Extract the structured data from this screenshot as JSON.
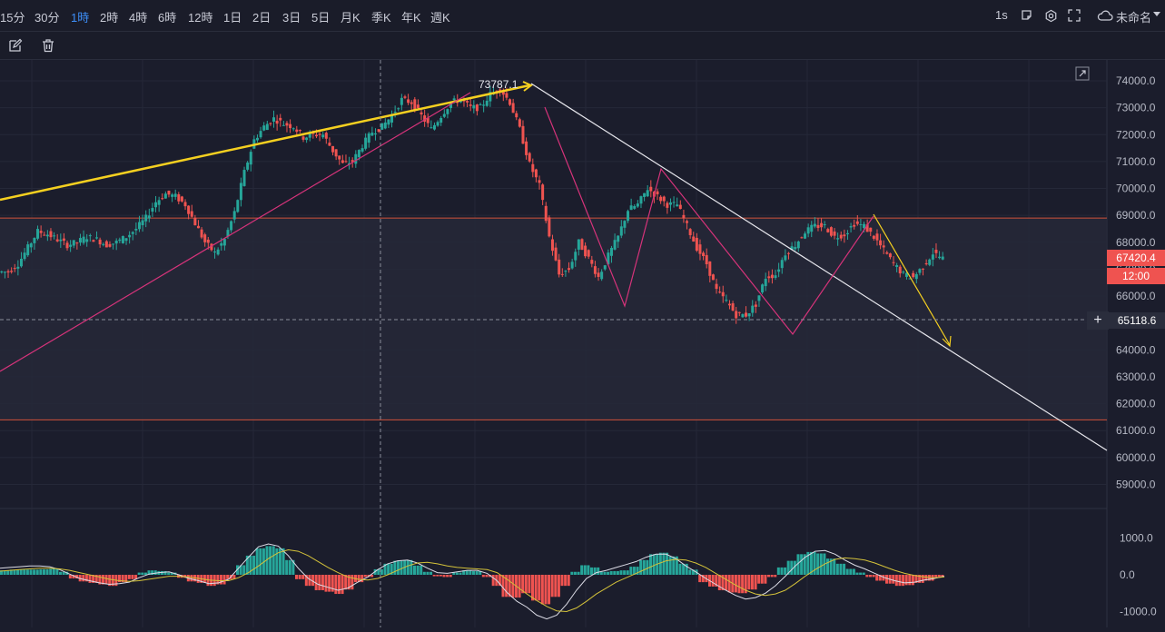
{
  "timeframes": [
    {
      "label": "15分",
      "active": false
    },
    {
      "label": "30分",
      "active": false
    },
    {
      "label": "1時",
      "active": true
    },
    {
      "label": "2時",
      "active": false
    },
    {
      "label": "4時",
      "active": false
    },
    {
      "label": "6時",
      "active": false
    },
    {
      "label": "12時",
      "active": false
    },
    {
      "label": "1日",
      "active": false
    },
    {
      "label": "2日",
      "active": false
    },
    {
      "label": "3日",
      "active": false
    },
    {
      "label": "5日",
      "active": false
    },
    {
      "label": "月K",
      "active": false
    },
    {
      "label": "季K",
      "active": false
    },
    {
      "label": "年K",
      "active": false
    },
    {
      "label": "週K",
      "active": false
    }
  ],
  "topright": {
    "interval": "1s",
    "layout_name": "未命名"
  },
  "icons": {
    "screenshot": "screenshot-icon",
    "settings": "gear-icon",
    "fullscreen": "fullscreen-icon",
    "cloud": "cloud-icon",
    "edit": "edit-icon",
    "delete": "trash-icon",
    "expand": "expand-icon",
    "add": "plus-icon"
  },
  "colors": {
    "up": "#26a69a",
    "down": "#ef5350",
    "accent": "#3d8ef8",
    "trend_yellow": "#f5d020",
    "trend_pink": "#d6337a",
    "trend_white": "#e8e8ee",
    "hline": "#d0523a",
    "macd_line": "#dcdce6",
    "signal_line": "#d4c23a"
  },
  "chart_data": {
    "type": "line",
    "title": "",
    "price_axis": {
      "ticks": [
        "74000.0",
        "73000.0",
        "72000.0",
        "71000.0",
        "70000.0",
        "69000.0",
        "68000.0",
        "67000.0",
        "66000.0",
        "65000.0",
        "64000.0",
        "63000.0",
        "62000.0",
        "61000.0",
        "60000.0",
        "59000.0"
      ],
      "range": [
        58400,
        74800
      ]
    },
    "peak_label": "73787.1",
    "current_price": "67420.4",
    "countdown": "12:00",
    "crosshair_price": "65118.6",
    "macd_axis": {
      "ticks": [
        "1000.0",
        "0.0",
        "-1000.0"
      ]
    },
    "horizontal_levels": [
      68900,
      61400
    ],
    "series": [
      {
        "values": [
          66900,
          66900,
          67200,
          67800,
          68400,
          68300,
          68100,
          67900,
          68000,
          68200,
          68100,
          67900,
          68000,
          68200,
          68500,
          68900,
          69500,
          69800,
          69700,
          69400,
          68700,
          68000,
          67600,
          68100,
          69100,
          70600,
          71800,
          72300,
          72600,
          72400,
          72300,
          71900,
          72000,
          72000,
          71400,
          70900,
          71000,
          71600,
          72100,
          72300,
          72700,
          73300,
          73200,
          72700,
          72200,
          72700,
          73200,
          73300,
          73000,
          73000,
          73500,
          73700,
          73200,
          72200,
          70900,
          70100,
          68200,
          66800,
          67000,
          68000,
          67400,
          66700,
          67500,
          68200,
          69200,
          69400,
          70000,
          69700,
          69400,
          69400,
          68600,
          67800,
          67200,
          66200,
          65800,
          65300,
          65300,
          65700,
          66700,
          66800,
          67600,
          67900,
          68400,
          68600,
          68600,
          68200,
          68300,
          68700,
          68600,
          68200,
          67700,
          67200,
          66800,
          66700,
          67100,
          67600,
          67400
        ]
      }
    ],
    "macd_histogram": [
      120,
      140,
      140,
      140,
      150,
      160,
      80,
      -100,
      -180,
      -220,
      -260,
      -300,
      -200,
      -120,
      60,
      120,
      100,
      60,
      -80,
      -180,
      -220,
      -300,
      -260,
      -120,
      260,
      520,
      720,
      780,
      720,
      400,
      -120,
      -300,
      -420,
      -460,
      -520,
      -400,
      -200,
      -60,
      150,
      300,
      380,
      400,
      250,
      80,
      -40,
      -60,
      60,
      120,
      100,
      -60,
      -300,
      -600,
      -620,
      -500,
      -700,
      -800,
      -600,
      -300,
      80,
      260,
      200,
      80,
      100,
      120,
      220,
      400,
      560,
      600,
      500,
      300,
      140,
      -200,
      -320,
      -420,
      -480,
      -500,
      -400,
      -240,
      -60,
      200,
      380,
      560,
      620,
      580,
      440,
      300,
      160,
      60,
      -60,
      -160,
      -240,
      -300,
      -280,
      -220,
      -160,
      -60
    ],
    "macd_line": [
      180,
      200,
      220,
      240,
      240,
      220,
      140,
      20,
      -100,
      -160,
      -220,
      -260,
      -240,
      -200,
      -80,
      20,
      60,
      80,
      0,
      -100,
      -160,
      -240,
      -220,
      -120,
      180,
      480,
      760,
      840,
      780,
      520,
      180,
      -100,
      -260,
      -340,
      -420,
      -360,
      -200,
      -60,
      140,
      300,
      380,
      400,
      320,
      180,
      60,
      40,
      80,
      120,
      120,
      40,
      -160,
      -480,
      -720,
      -880,
      -1100,
      -1200,
      -1100,
      -800,
      -420,
      -100,
      60,
      120,
      200,
      280,
      360,
      480,
      560,
      560,
      440,
      240,
      80,
      -100,
      -260,
      -420,
      -560,
      -660,
      -620,
      -500,
      -300,
      -40,
      240,
      480,
      640,
      660,
      560,
      400,
      260,
      160,
      40,
      -80,
      -160,
      -220,
      -200,
      -140,
      -100,
      -40
    ],
    "signal_line": [
      100,
      120,
      140,
      160,
      180,
      180,
      160,
      120,
      60,
      0,
      -60,
      -120,
      -160,
      -180,
      -160,
      -120,
      -80,
      -40,
      -40,
      -60,
      -100,
      -140,
      -160,
      -160,
      -80,
      60,
      240,
      440,
      600,
      680,
      640,
      520,
      360,
      200,
      60,
      -60,
      -120,
      -140,
      -100,
      0,
      120,
      240,
      320,
      340,
      300,
      240,
      200,
      180,
      160,
      140,
      60,
      -120,
      -320,
      -520,
      -700,
      -860,
      -980,
      -1000,
      -900,
      -720,
      -520,
      -360,
      -200,
      -80,
      40,
      160,
      280,
      380,
      420,
      400,
      320,
      200,
      40,
      -120,
      -280,
      -420,
      -520,
      -560,
      -520,
      -420,
      -240,
      -40,
      140,
      300,
      420,
      460,
      440,
      400,
      320,
      220,
      120,
      40,
      -20,
      -60,
      -80,
      -60
    ]
  }
}
